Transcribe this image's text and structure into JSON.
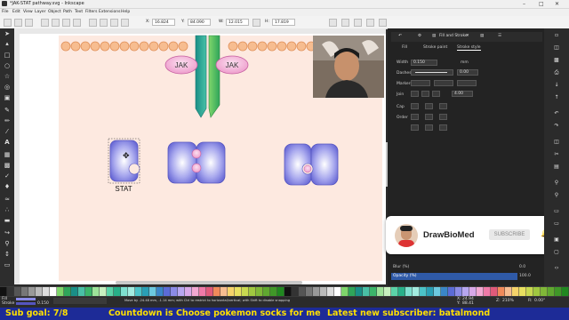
{
  "window": {
    "title": "*JAK-STAT pathway.svg - Inkscape"
  },
  "menu": [
    "File",
    "Edit",
    "View",
    "Layer",
    "Object",
    "Path",
    "Text",
    "Filters",
    "Extensions",
    "Help"
  ],
  "toolbar": {
    "x_label": "X:",
    "x_value": "16.824",
    "y_label": "Y:",
    "y_value": "84.090",
    "w_label": "W:",
    "w_value": "12.015",
    "h_label": "H:",
    "h_value": "17.819"
  },
  "canvas": {
    "receptor_left_label": "JAK",
    "receptor_right_label": "JAK",
    "stat_label": "STAT"
  },
  "dock": {
    "tab_label": "Fill and Stroke",
    "fill_tab": "Fill",
    "stroke_paint_tab": "Stroke paint",
    "stroke_style_tab": "Stroke style",
    "width_label": "Width",
    "width_value": "0.150",
    "width_unit": "mm",
    "dashes_label": "Dashes",
    "dashes_value": "0.00",
    "markers_label": "Markers",
    "join_label": "Join",
    "join_value": "4.00",
    "cap_label": "Cap",
    "order_label": "Order",
    "blur_label": "Blur (%)",
    "blur_value": "0.0",
    "opacity_label": "Opacity (%)",
    "opacity_value": "100.0"
  },
  "subscribe_card": {
    "channel": "DrawBioMed",
    "button": "SUBSCRIBE"
  },
  "status": {
    "fill_label": "Fill",
    "stroke_label": "Stroke",
    "stroke_value": "0.150",
    "message": "Move by -24.48 mm, -1.14 mm; with Ctrl to restrict to horizontal/vertical; with Shift to disable snapping",
    "x_label": "X:",
    "x_value": "24.94",
    "y_label": "Y:",
    "y_value": "88.41",
    "zoom_label": "Z:",
    "zoom_value": "210%",
    "rotation_label": "R:",
    "rotation_value": "0.00°"
  },
  "ticker": {
    "goal": "Sub goal: 7/8",
    "countdown": "Countdown is Choose pokemon socks for me",
    "latest": "Latest new subscriber: batalmond"
  },
  "colors": {
    "ticker_bg": "#1d2b97",
    "ticker_text": "#ffe000",
    "page_bg": "#fde9e0",
    "protein_fill": "#7f7fe0",
    "jak_fill": "#f2a8d2",
    "receptor_green": "#3bb56a",
    "receptor_teal": "#20a08f",
    "lipid_head": "#f6b98c"
  }
}
